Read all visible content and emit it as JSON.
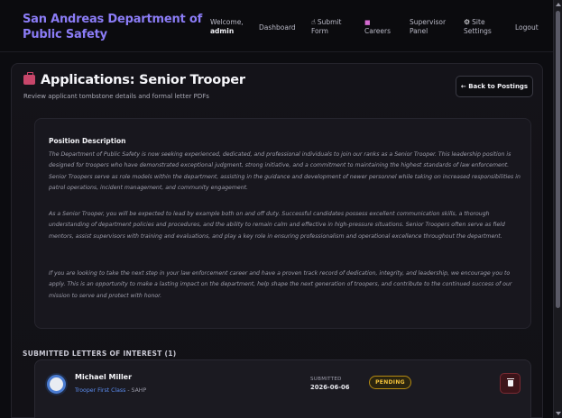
{
  "nav": {
    "brand": "San Andreas Department of Public Safety",
    "welcome": "Welcome,",
    "username": "admin",
    "dashboard": "Dashboard",
    "submit_form": "Submit Form",
    "careers": "Careers",
    "supervisor_panel": "Supervisor Panel",
    "site_settings": "Site Settings",
    "logout": "Logout"
  },
  "page": {
    "title": "Applications: Senior Trooper",
    "subtitle": "Review applicant tombstone details and formal letter PDFs",
    "back_button": "← Back to Postings"
  },
  "description": {
    "heading": "Position Description",
    "paragraphs": [
      "The Department of Public Safety is now seeking experienced, dedicated, and professional individuals to join our ranks as a Senior Trooper. This leadership position is designed for troopers who have demonstrated exceptional judgment, strong initiative, and a commitment to maintaining the highest standards of law enforcement. Senior Troopers serve as role models within the department, assisting in the guidance and development of newer personnel while taking on increased responsibilities in patrol operations, incident management, and community engagement.",
      "As a Senior Trooper, you will be expected to lead by example both on and off duty. Successful candidates possess excellent communication skills, a thorough understanding of department policies and procedures, and the ability to remain calm and effective in high-pressure situations. Senior Troopers often serve as field mentors, assist supervisors with training and evaluations, and play a key role in ensuring professionalism and operational excellence throughout the department.",
      "If you are looking to take the next step in your law enforcement career and have a proven track record of dedication, integrity, and leadership, we encourage you to apply. This is an opportunity to make a lasting impact on the department, help shape the next generation of troopers, and contribute to the continued success of our mission to serve and protect with honor."
    ]
  },
  "letters": {
    "header": "SUBMITTED LETTERS OF INTEREST (1)",
    "items": [
      {
        "name": "Michael Miller",
        "rank": "Trooper First Class",
        "separator": " - ",
        "agency": "SAHP",
        "submitted_label": "SUBMITTED",
        "submitted_date": "2026-06-06",
        "status": "PENDING"
      }
    ]
  },
  "colors": {
    "brand": "#8b7cf6",
    "pending": "#f5c33b",
    "rank_link": "#5b8cf0",
    "danger": "#7a2a33"
  },
  "icons": {
    "submit_form": "hand-pointer-icon",
    "careers": "briefcase-icon",
    "site_settings": "gear-icon",
    "page_title": "briefcase-icon",
    "delete": "trash-icon"
  }
}
